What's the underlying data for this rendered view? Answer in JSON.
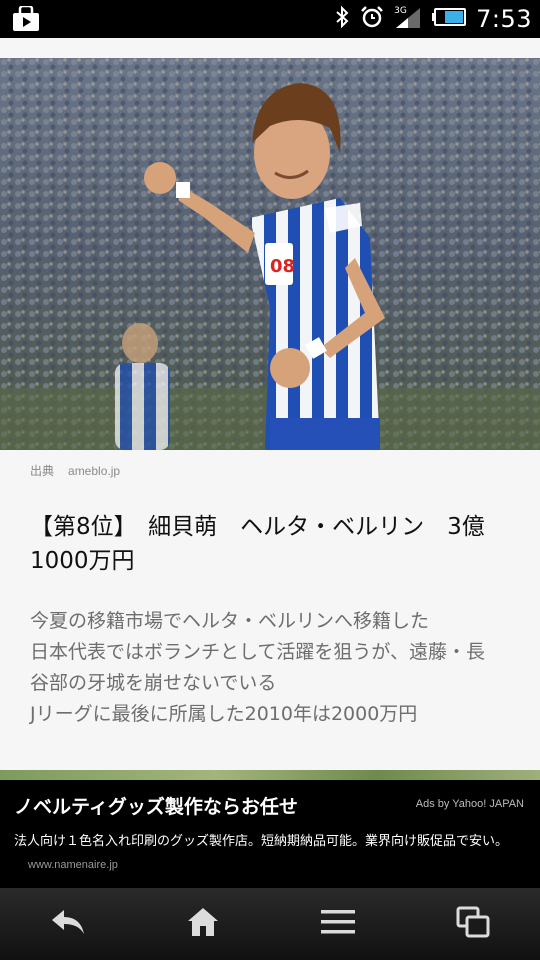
{
  "status_bar": {
    "time": "7:53",
    "network_label": "3G",
    "icons": [
      "store-bag-icon",
      "bluetooth-icon",
      "alarm-icon",
      "signal-icon",
      "battery-icon"
    ]
  },
  "article": {
    "source_label": "出典",
    "source_site": "ameblo.jp",
    "headline": "【第8位】　細貝萌　ヘルタ・ベルリン　3億1000万円",
    "body_lines": [
      "今夏の移籍市場でヘルタ・ベルリンへ移籍した",
      "日本代表ではボランチとして活躍を狙うが、遠藤・長",
      "谷部の牙城を崩せないでいる",
      "Jリーグに最後に所属した2010年は2000万円"
    ],
    "jersey_number": "08"
  },
  "ad": {
    "title": "ノベルティグッズ製作ならお任せ",
    "provider": "Ads by Yahoo! JAPAN",
    "description": "法人向け１色名入れ印刷のグッズ製作店。短納期納品可能。業界向け販促品で安い。",
    "url": "www.namenaire.jp"
  },
  "nav": {
    "icons": [
      "back-icon",
      "home-icon",
      "menu-icon",
      "recent-apps-icon"
    ]
  },
  "colors": {
    "jersey_blue": "#1f4fb3",
    "page_bg": "#f6f6f6",
    "headline_text": "#111111",
    "body_text": "#6e6e6e"
  }
}
